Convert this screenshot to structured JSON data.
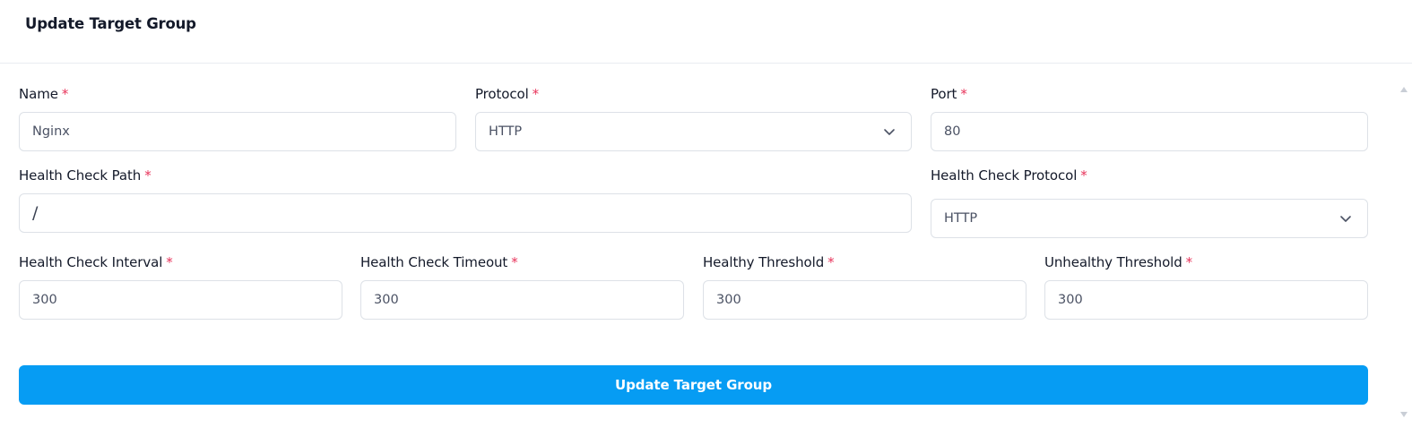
{
  "header": {
    "title": "Update Target Group"
  },
  "required_marker": "*",
  "fields": {
    "name": {
      "label": "Name",
      "value": "Nginx"
    },
    "protocol": {
      "label": "Protocol",
      "value": "HTTP"
    },
    "port": {
      "label": "Port",
      "value": "80"
    },
    "health_check_path": {
      "label": "Health Check Path",
      "value": "/"
    },
    "health_check_protocol": {
      "label": "Health Check Protocol",
      "value": "HTTP"
    },
    "health_check_interval": {
      "label": "Health Check Interval",
      "value": "300"
    },
    "health_check_timeout": {
      "label": "Health Check Timeout",
      "value": "300"
    },
    "healthy_threshold": {
      "label": "Healthy Threshold",
      "value": "300"
    },
    "unhealthy_threshold": {
      "label": "Unhealthy Threshold",
      "value": "300"
    }
  },
  "submit": {
    "label": "Update Target Group"
  },
  "colors": {
    "primary": "#069cf3",
    "required": "#e8335a",
    "border": "#dde1e7"
  },
  "icons": {
    "select_arrow": "chevron-down-icon"
  }
}
